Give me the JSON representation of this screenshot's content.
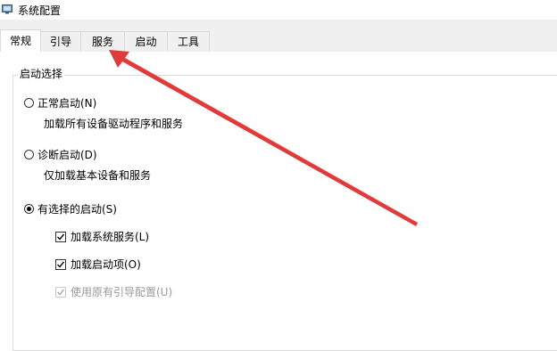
{
  "window": {
    "title": "系统配置",
    "icon": "msconfig-icon"
  },
  "tabs": [
    {
      "label": "常规",
      "active": true
    },
    {
      "label": "引导",
      "active": false
    },
    {
      "label": "服务",
      "active": false
    },
    {
      "label": "启动",
      "active": false
    },
    {
      "label": "工具",
      "active": false
    }
  ],
  "startup_group": {
    "legend": "启动选择",
    "normal": {
      "label": "正常启动(N)",
      "desc": "加载所有设备驱动程序和服务",
      "selected": false
    },
    "diagnostic": {
      "label": "诊断启动(D)",
      "desc": "仅加载基本设备和服务",
      "selected": false
    },
    "selective": {
      "label": "有选择的启动(S)",
      "selected": true,
      "options": [
        {
          "label": "加载系统服务(L)",
          "checked": true,
          "enabled": true
        },
        {
          "label": "加载启动项(O)",
          "checked": true,
          "enabled": true
        },
        {
          "label": "使用原有引导配置(U)",
          "checked": true,
          "enabled": false
        }
      ]
    }
  },
  "annotation": {
    "color": "#e03a3a",
    "points_to": "服务"
  }
}
